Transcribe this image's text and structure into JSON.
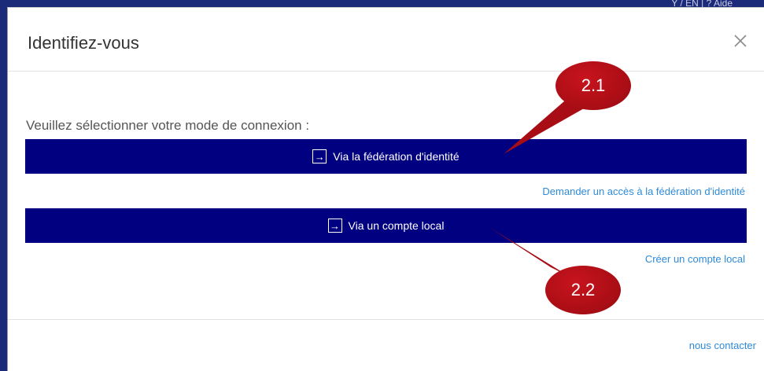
{
  "background": {
    "top_text": "Y / EN   | ?  Aide"
  },
  "modal": {
    "title": "Identifiez-vous",
    "close_label": "×",
    "prompt": "Veuillez sélectionner votre mode de connexion :",
    "federation_button": "Via la fédération d'identité",
    "federation_link": "Demander un accès à la fédération d'identité",
    "local_button": "Via un compte local",
    "local_link": "Créer un compte local",
    "contact_link": "nous contacter"
  },
  "annotations": {
    "callout_1": "2.1",
    "callout_2": "2.2"
  },
  "colors": {
    "button_bg": "#000080",
    "link": "#2e8ad8",
    "callout": "#b01018"
  },
  "icons": {
    "button_icon": "arrow-right-box-icon",
    "close_icon": "close-icon"
  }
}
